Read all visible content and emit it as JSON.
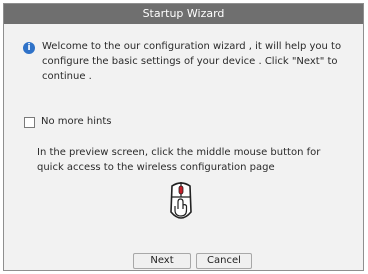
{
  "window": {
    "title": "Startup Wizard"
  },
  "welcome": {
    "icon": "info-icon",
    "icon_glyph": "i",
    "text": "Welcome to the our configuration wizard , it will help you to configure the basic settings of your device . Click \"Next\" to continue ."
  },
  "hints": {
    "checkbox_label": "No more hints",
    "checked": false
  },
  "preview_hint": {
    "text": "In the preview screen, click the middle mouse button for quick access to the wireless configuration page",
    "icon": "mouse-middle-click-icon"
  },
  "buttons": {
    "next_label": "Next",
    "cancel_label": "Cancel"
  },
  "colors": {
    "titlebar": "#6f6f6f",
    "info_icon": "#2f72c8",
    "middle_button": "#c8202a"
  }
}
